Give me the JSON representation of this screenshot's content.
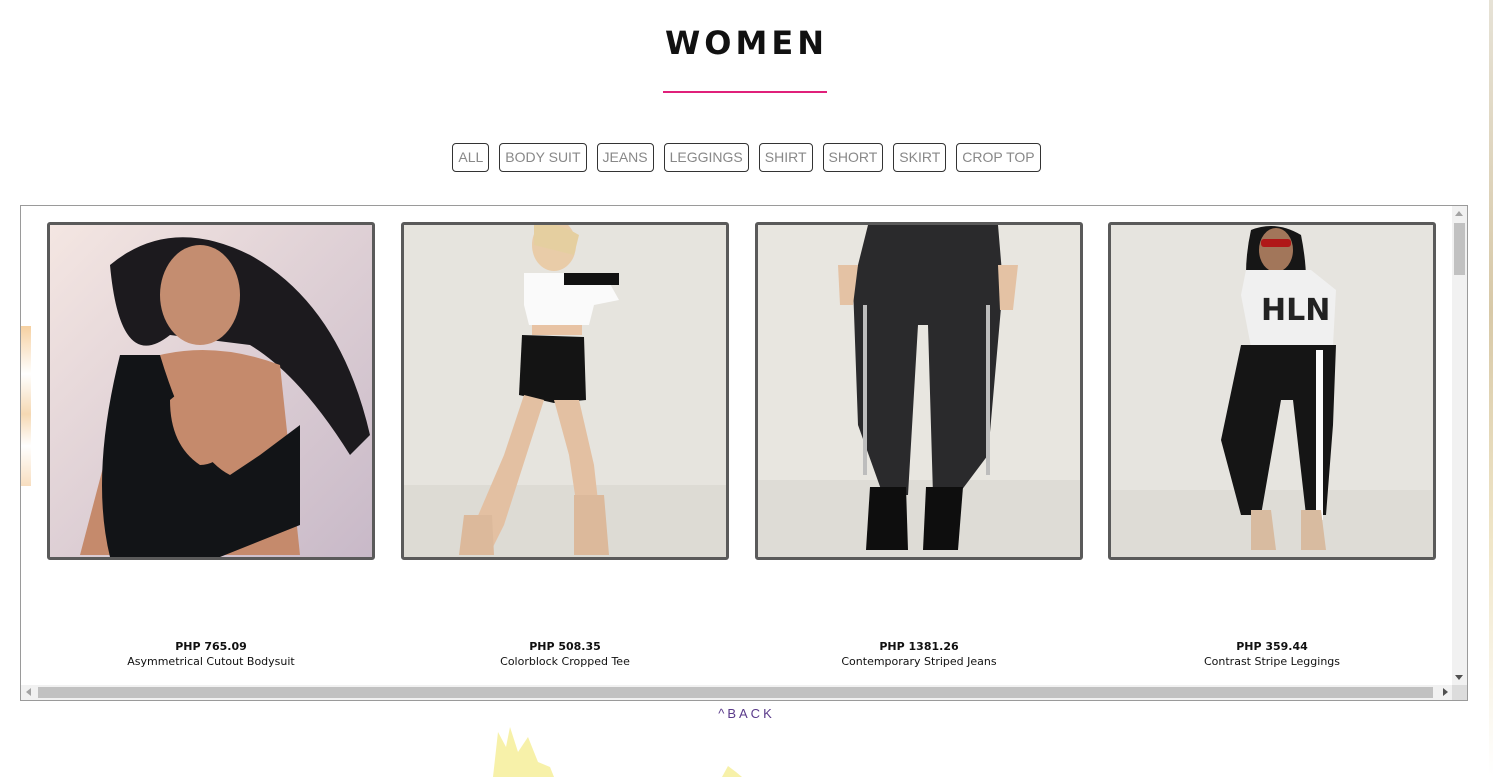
{
  "page": {
    "title": "WOMEN",
    "accent_color": "#e0207a"
  },
  "filters": [
    {
      "label": "ALL"
    },
    {
      "label": "BODY SUIT"
    },
    {
      "label": "JEANS"
    },
    {
      "label": "LEGGINGS"
    },
    {
      "label": "SHIRT"
    },
    {
      "label": "SHORT"
    },
    {
      "label": "SKIRT"
    },
    {
      "label": "CROP TOP"
    }
  ],
  "products": [
    {
      "price": "PHP 765.09",
      "name": "Asymmetrical Cutout Bodysuit",
      "image_icon": "bodysuit-photo"
    },
    {
      "price": "PHP 508.35",
      "name": "Colorblock Cropped Tee",
      "image_icon": "cropped-tee-photo"
    },
    {
      "price": "PHP 1381.26",
      "name": "Contemporary Striped Jeans",
      "image_icon": "striped-jeans-photo"
    },
    {
      "price": "PHP 359.44",
      "name": "Contrast Stripe Leggings",
      "image_icon": "stripe-leggings-photo"
    }
  ],
  "back": {
    "label": "^BACK"
  }
}
